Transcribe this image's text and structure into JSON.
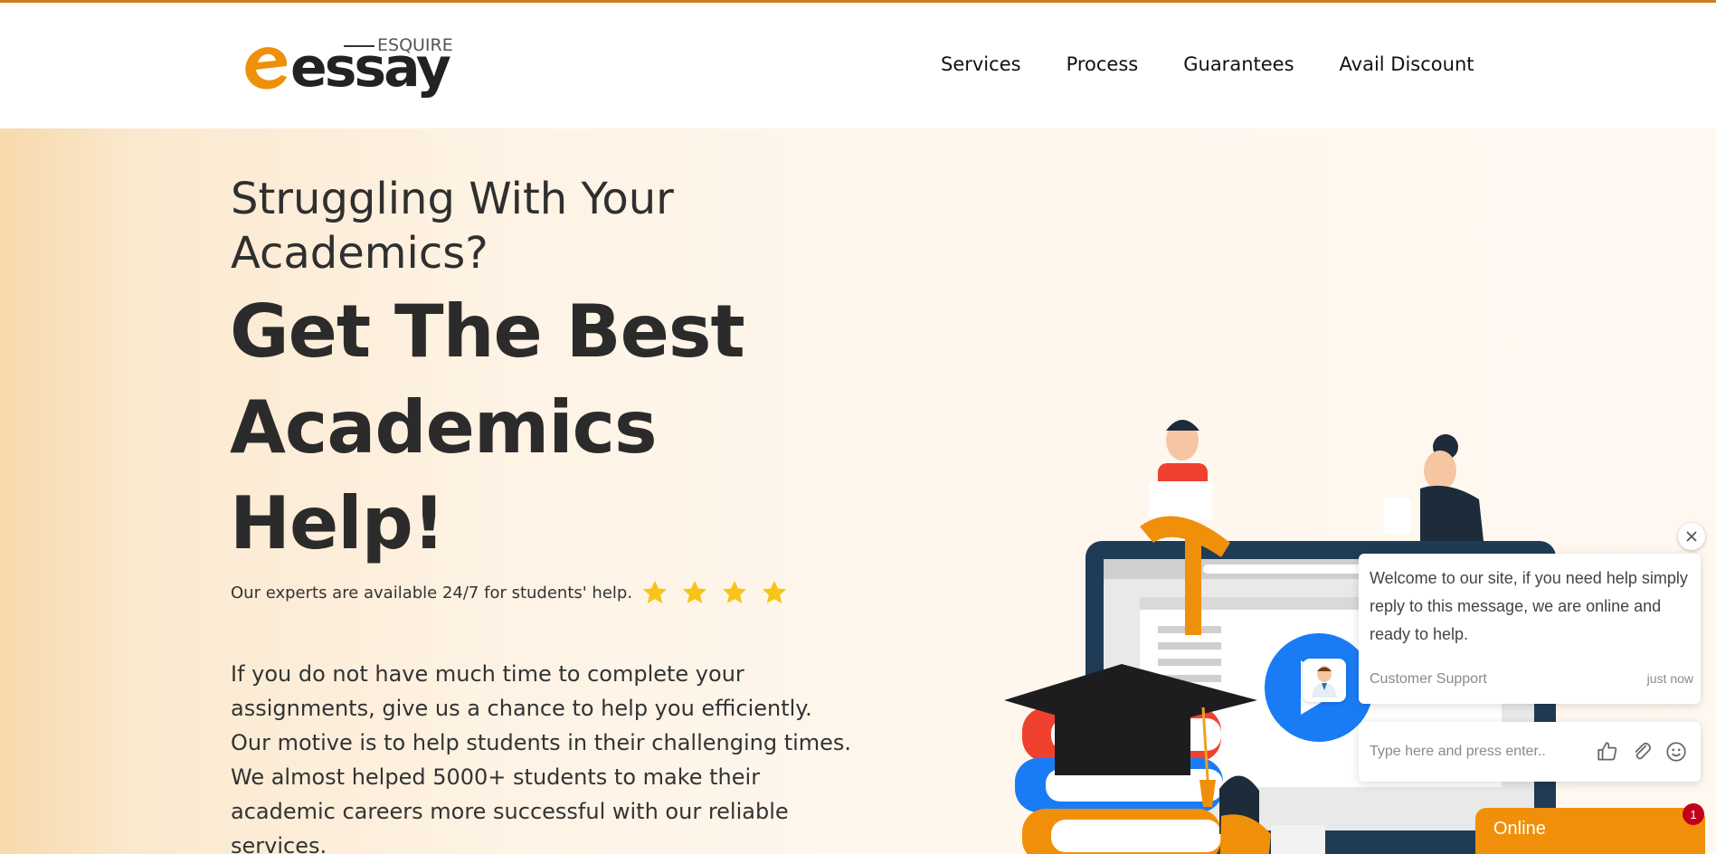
{
  "header": {
    "logo": {
      "brand": "essay",
      "tagline": "ESQUIRE"
    },
    "nav": [
      {
        "label": "Services"
      },
      {
        "label": "Process"
      },
      {
        "label": "Guarantees"
      },
      {
        "label": "Avail Discount"
      }
    ]
  },
  "hero": {
    "subheading": "Struggling With Your Academics?",
    "heading": "Get The Best Academics Help!",
    "availability": "Our experts are available 24/7 for students' help.",
    "rating_stars": 4,
    "paragraph": "If you do not have much time to complete your assignments, give us a chance to help you efficiently. Our motive is to help students in their challenging times. We almost helped 5000+ students to make their academic careers more successful with our reliable services."
  },
  "chat": {
    "message": "Welcome to our site, if you need help simply reply to this message, we are online and ready to help.",
    "from": "Customer Support",
    "time": "just now",
    "input_placeholder": "Type here and press enter..",
    "status_label": "Online",
    "unread_count": "1"
  },
  "colors": {
    "accent": "#f0900a",
    "heading": "#2b2b2b",
    "star": "#f7c417",
    "badge": "#c0001a"
  }
}
